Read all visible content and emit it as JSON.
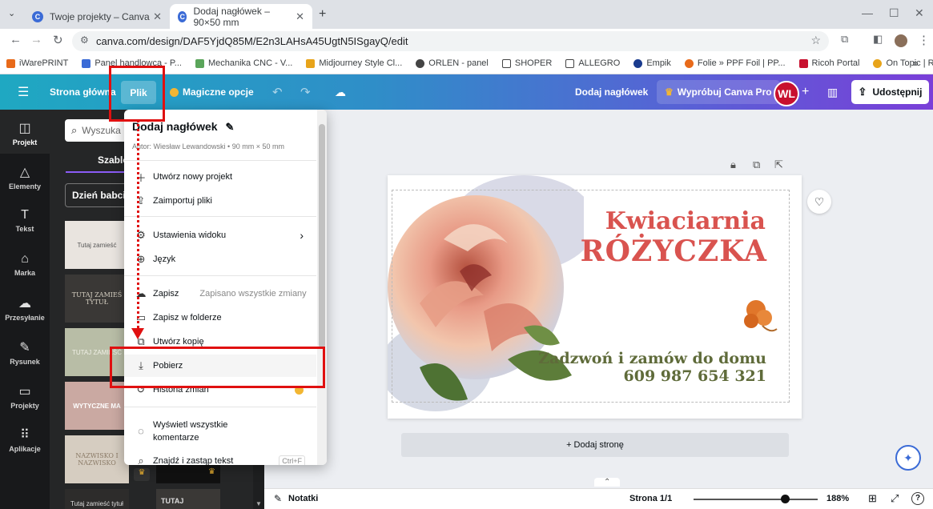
{
  "browser": {
    "tabs": [
      {
        "title": "Twoje projekty – Canva"
      },
      {
        "title": "Dodaj nagłówek – 90×50 mm"
      }
    ],
    "url": "canva.com/design/DAF5YjdQ85M/E2n3LAHsA45UgtN5ISgayQ/edit",
    "bookmarks": [
      {
        "label": "iWarePRINT",
        "color": "#e86a1a"
      },
      {
        "label": "Panel handlowca - P...",
        "color": "#3b6bd6"
      },
      {
        "label": "Mechanika CNC - V...",
        "color": "#5aa55a"
      },
      {
        "label": "Midjourney Style Cl...",
        "color": "#e8a41a"
      },
      {
        "label": "ORLEN - panel",
        "color": "#444444"
      },
      {
        "label": "SHOPER",
        "color": "#444444"
      },
      {
        "label": "ALLEGRO",
        "color": "#444444"
      },
      {
        "label": "Empik",
        "color": "#1a3b8e"
      },
      {
        "label": "Folie » PPF Foil | PP...",
        "color": "#e86a1a"
      },
      {
        "label": "Ricoh Portal",
        "color": "#c8102e"
      },
      {
        "label": "On Topic | Ricoh Bu...",
        "color": "#e8a41a"
      }
    ]
  },
  "header": {
    "home": "Strona główna",
    "file": "Plik",
    "magic": "Magiczne opcje",
    "doc_title": "Dodaj nagłówek",
    "try_pro": "Wypróbuj Canva Pro",
    "avatar": "WL",
    "share": "Udostępnij"
  },
  "rail": [
    {
      "label": "Projekt",
      "icon": "layout-icon"
    },
    {
      "label": "Elementy",
      "icon": "shapes-icon"
    },
    {
      "label": "Tekst",
      "icon": "text-icon"
    },
    {
      "label": "Marka",
      "icon": "brand-icon"
    },
    {
      "label": "Przesyłanie",
      "icon": "upload-icon"
    },
    {
      "label": "Rysunek",
      "icon": "draw-icon"
    },
    {
      "label": "Projekty",
      "icon": "folder-icon"
    },
    {
      "label": "Aplikacje",
      "icon": "apps-icon"
    }
  ],
  "panel": {
    "search_placeholder": "Wyszuka",
    "tab": "Szablo",
    "filter": "Dzień babci",
    "thumbs": [
      {
        "text": "Tutaj zamieść",
        "bg": "#e9e4df",
        "fg": "#555555"
      },
      {
        "text": "TUTAJ ZAMIEŚ TYTUŁ",
        "bg": "#3a3836",
        "fg": "#d8d2c4"
      },
      {
        "text": "TUTAJ ZAMIEŚĆ",
        "bg": "#b8bda6",
        "fg": "#f0f0e6"
      },
      {
        "text": "WYTYCZNE MA",
        "bg": "#caa9a2",
        "fg": "#ffffff"
      },
      {
        "text": "NAZWISKO I NAZWISKO",
        "bg": "#d6cdc1",
        "fg": "#8a7a66"
      },
      {
        "text": "Tutaj zamieść tytuł",
        "bg": "#2d2c2b",
        "fg": "#dddddd"
      }
    ],
    "thumb2": "TUTAJ"
  },
  "menu": {
    "title": "Dodaj nagłówek",
    "subtitle": "Autor: Wiesław Lewandowski • 90 mm × 50 mm",
    "items": [
      {
        "label": "Utwórz nowy projekt",
        "icon": "plus-icon"
      },
      {
        "label": "Zaimportuj pliki",
        "icon": "import-icon"
      },
      {
        "label": "Ustawienia widoku",
        "icon": "settings-icon"
      },
      {
        "label": "Język",
        "icon": "globe-icon"
      },
      {
        "label": "Zapisz",
        "icon": "cloud-icon",
        "note": "Zapisano wszystkie zmiany"
      },
      {
        "label": "Zapisz w folderze",
        "icon": "folder-icon"
      },
      {
        "label": "Utwórz kopię",
        "icon": "copy-icon"
      },
      {
        "label": "Pobierz",
        "icon": "download-icon"
      },
      {
        "label": "Historia zmian",
        "icon": "history-icon"
      },
      {
        "label": "Wyświetl wszystkie komentarze",
        "icon": "comment-icon"
      },
      {
        "label": "Znajdź i zastąp tekst",
        "icon": "search-icon",
        "shortcut": "Ctrl+F"
      }
    ]
  },
  "card": {
    "line1": "Kwiaciarnia",
    "line2": "RÓŻYCZKA",
    "line3": "Zadzwoń i zamów do domu",
    "line4": "609 987 654 321"
  },
  "canvas": {
    "add_page": "+ Dodaj stronę"
  },
  "footer": {
    "notes": "Notatki",
    "page": "Strona 1/1",
    "zoom": "188%",
    "help": "?"
  }
}
